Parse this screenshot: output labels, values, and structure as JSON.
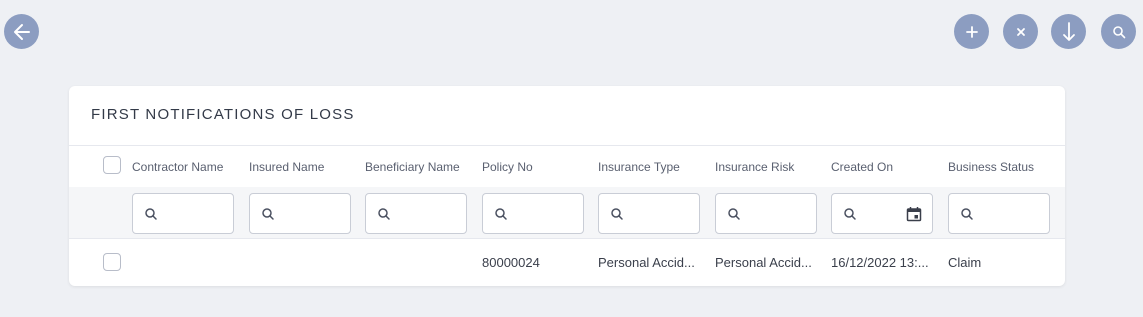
{
  "toolbar": {
    "back": "back-arrow-icon",
    "add": "plus-icon",
    "clear": "close-icon",
    "download": "arrow-down-icon",
    "search": "search-icon",
    "button_color": "#8c9dc1"
  },
  "card": {
    "title": "FIRST NOTIFICATIONS OF LOSS"
  },
  "table": {
    "columns": [
      "Contractor Name",
      "Insured Name",
      "Beneficiary Name",
      "Policy No",
      "Insurance Type",
      "Insurance Risk",
      "Created On",
      "Business Status"
    ],
    "rows": [
      {
        "contractor_name": "",
        "insured_name": "",
        "beneficiary_name": "",
        "policy_no": "80000024",
        "insurance_type": "Personal Accid...",
        "insurance_risk": "Personal Accid...",
        "created_on": "16/12/2022 13:...",
        "business_status": "Claim"
      }
    ]
  }
}
